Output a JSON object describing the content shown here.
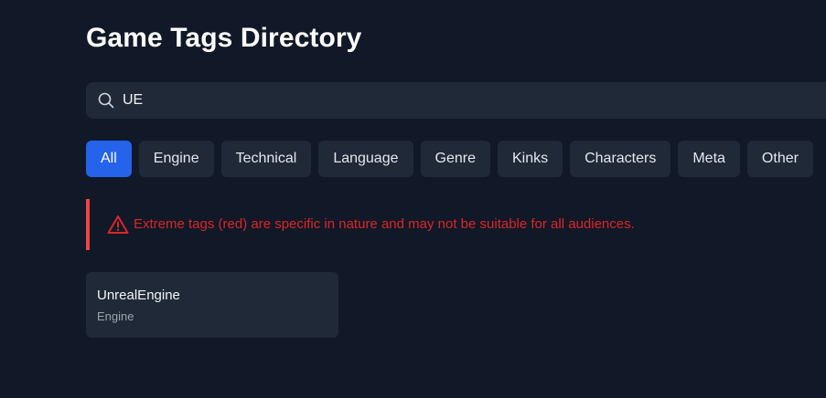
{
  "page": {
    "title": "Game Tags Directory"
  },
  "search": {
    "value": "UE",
    "icon": "search-icon"
  },
  "filters": [
    {
      "label": "All",
      "active": true
    },
    {
      "label": "Engine",
      "active": false
    },
    {
      "label": "Technical",
      "active": false
    },
    {
      "label": "Language",
      "active": false
    },
    {
      "label": "Genre",
      "active": false
    },
    {
      "label": "Kinks",
      "active": false
    },
    {
      "label": "Characters",
      "active": false
    },
    {
      "label": "Meta",
      "active": false
    },
    {
      "label": "Other",
      "active": false
    }
  ],
  "warning": {
    "icon": "warning-triangle-icon",
    "text": "Extreme tags (red) are specific in nature and may not be suitable for all audiences.",
    "color": "#dc2626"
  },
  "results": [
    {
      "name": "UnrealEngine",
      "category": "Engine"
    }
  ],
  "colors": {
    "background": "#111827",
    "surface": "#1f2937",
    "accent": "#2563eb",
    "danger": "#ef4444"
  }
}
